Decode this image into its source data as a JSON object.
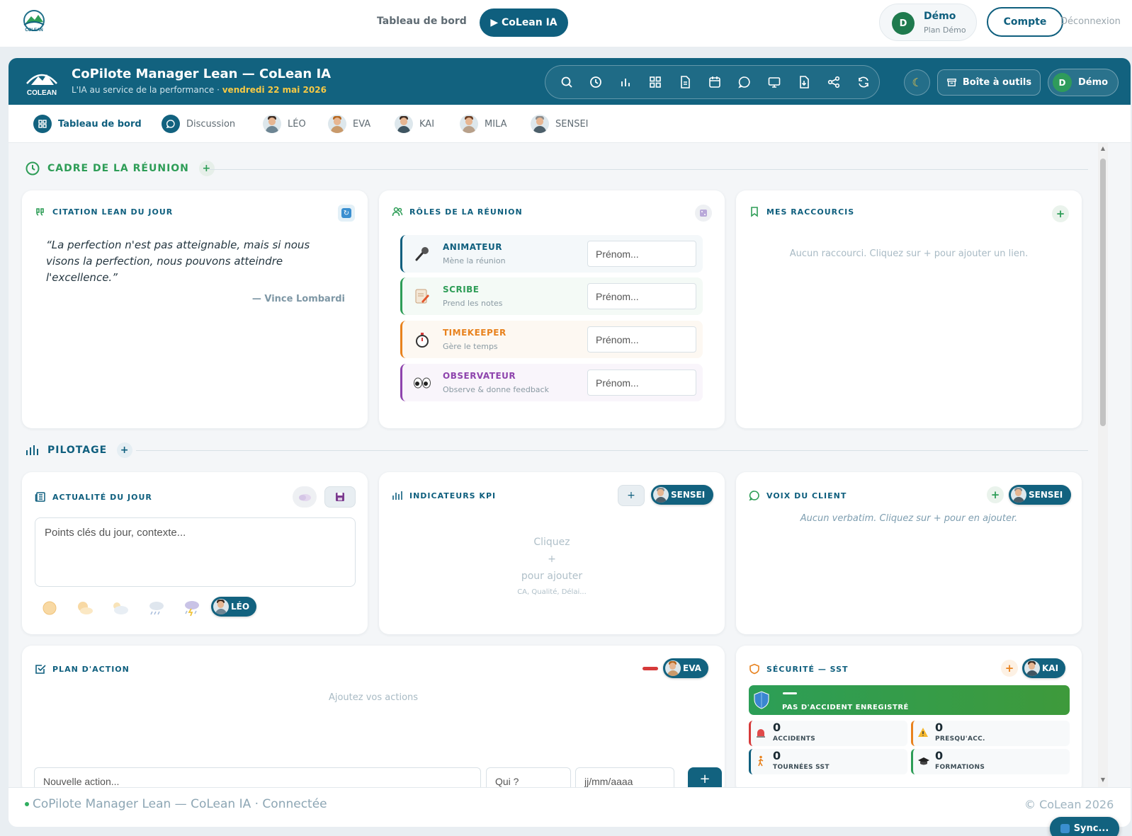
{
  "topnav": {
    "dashboard_link": "Tableau de bord",
    "ia_button": "▶ CoLean IA",
    "user_name": "Démo",
    "user_plan": "Plan Démo",
    "user_initial": "D",
    "account_button": "Compte",
    "logout_link": "Déconnexion"
  },
  "header": {
    "title": "CoPilote Manager Lean — CoLean IA",
    "subtitle": "L'IA au service de la performance · ",
    "date": "vendredi 22 mai 2026",
    "logo_text": "COLEAN",
    "icons": [
      "search-icon",
      "history-icon",
      "chart-icon",
      "grid-icon",
      "document-icon",
      "calendar-icon",
      "chat-icon",
      "monitor-icon",
      "download-icon",
      "share-icon",
      "refresh-icon"
    ],
    "theme_icon": "moon-icon",
    "toolbox_label": "Boîte à outils",
    "user_name": "Démo",
    "user_initial": "D"
  },
  "tabs": [
    {
      "label": "Tableau de bord",
      "icon": "grid-icon",
      "active": true
    },
    {
      "label": "Discussion",
      "icon": "chat-icon"
    },
    {
      "label": "LÉO"
    },
    {
      "label": "EVA"
    },
    {
      "label": "KAI"
    },
    {
      "label": "MILA"
    },
    {
      "label": "SENSEI"
    }
  ],
  "sections": {
    "cadre": "CADRE DE LA RÉUNION",
    "pilotage": "PILOTAGE"
  },
  "quote_card": {
    "title": "CITATION LEAN DU JOUR",
    "quote": "“La perfection n'est pas atteignable, mais si nous visons la perfection, nous pouvons atteindre l'excellence.”",
    "author": "— Vince Lombardi"
  },
  "roles_card": {
    "title": "RÔLES DE LA RÉUNION",
    "placeholder": "Prénom...",
    "roles": [
      {
        "name": "ANIMATEUR",
        "desc": "Mène la réunion",
        "color": "#0f5f7e",
        "icon": "microphone-icon"
      },
      {
        "name": "SCRIBE",
        "desc": "Prend les notes",
        "color": "#2e9d57",
        "icon": "memo-icon"
      },
      {
        "name": "TIMEKEEPER",
        "desc": "Gère le temps",
        "color": "#e8821e",
        "icon": "stopwatch-icon"
      },
      {
        "name": "OBSERVATEUR",
        "desc": "Observe & donne feedback",
        "color": "#8e44ad",
        "icon": "eyes-icon"
      }
    ]
  },
  "shortcuts_card": {
    "title": "MES RACCOURCIS",
    "empty": "Aucun raccourci. Cliquez sur + pour ajouter un lien."
  },
  "news_card": {
    "title": "ACTUALITÉ DU JOUR",
    "placeholder": "Points clés du jour, contexte...",
    "owner": "LÉO",
    "weather_icons": [
      "sun-icon",
      "sun-cloud-icon",
      "cloud-sun-icon",
      "rain-icon",
      "storm-icon"
    ]
  },
  "kpi_card": {
    "title": "INDICATEURS KPI",
    "owner": "SENSEI",
    "add_label": "+",
    "hint_line1": "Cliquez",
    "hint_line2": "+",
    "hint_line3": "pour ajouter",
    "hint_line4": "CA, Qualité, Délai..."
  },
  "voice_card": {
    "title": "VOIX DU CLIENT",
    "owner": "SENSEI",
    "empty": "Aucun verbatim. Cliquez sur + pour en ajouter."
  },
  "plan_card": {
    "title": "PLAN D'ACTION",
    "owner": "EVA",
    "empty": "Ajoutez vos actions",
    "new_action_placeholder": "Nouvelle action...",
    "who_placeholder": "Qui ?",
    "date_placeholder": "jj/mm/aaaa",
    "add_label": "+"
  },
  "safety_card": {
    "title": "SÉCURITÉ — SST",
    "owner": "KAI",
    "banner": "PAS D'ACCIDENT ENREGISTRÉ",
    "stats": [
      {
        "value": "0",
        "label": "ACCIDENTS",
        "color": "#d63a3a",
        "icon": "siren-icon"
      },
      {
        "value": "0",
        "label": "PRESQU'ACC.",
        "color": "#e8821e",
        "icon": "warning-icon"
      },
      {
        "value": "0",
        "label": "TOURNÉES SST",
        "color": "#0f5f7e",
        "icon": "walker-icon"
      },
      {
        "value": "0",
        "label": "FORMATIONS",
        "color": "#2e9d57",
        "icon": "graduation-icon"
      }
    ]
  },
  "footer": {
    "status": "CoPilote Manager Lean — CoLean IA · Connectée",
    "copyright": "© CoLean 2026",
    "sync": "Sync..."
  },
  "colors": {
    "brand": "#12627f",
    "accent_green": "#2e9d57"
  }
}
